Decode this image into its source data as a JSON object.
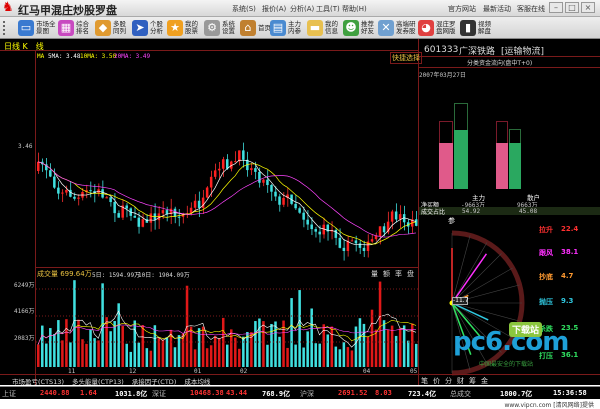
{
  "titlebar": {
    "app_title": "红马甲混庄炒股罗盘",
    "menus": [
      "系统(S)",
      "报价(A)",
      "分析(A)",
      "工具(T)",
      "帮助(H)"
    ],
    "links": [
      "官方网站",
      "最新活动",
      "客服在线"
    ],
    "window_buttons": [
      "–",
      "□",
      "×"
    ]
  },
  "toolbar": {
    "items": [
      {
        "label": "市场全景图",
        "icon": "monitor-icon",
        "color": "#3a7ad0"
      },
      {
        "label": "综合排名",
        "icon": "grid-icon",
        "color": "#c84ac0"
      },
      {
        "label": "多股同列",
        "icon": "cubes-icon",
        "color": "#e09a30"
      },
      {
        "label": "个股分析",
        "icon": "arrow-icon",
        "color": "#3060c0"
      },
      {
        "label": "我的股票",
        "icon": "star-icon",
        "color": "#f0a020"
      },
      {
        "label": "系统设置",
        "icon": "gear-icon",
        "color": "#999999"
      },
      {
        "label": "首页",
        "icon": "home-icon",
        "color": "#c08030"
      },
      {
        "label": "主力内参",
        "icon": "book-icon",
        "color": "#4a8ad0"
      },
      {
        "label": "我的信息",
        "icon": "folder-icon",
        "color": "#e8c050"
      },
      {
        "label": "推荐好友",
        "icon": "users-icon",
        "color": "#40a040"
      },
      {
        "label": "高端研发券股",
        "icon": "map-icon",
        "color": "#70a0d0"
      },
      {
        "label": "混庄罗盘网版",
        "icon": "pie-icon",
        "color": "#e04040"
      },
      {
        "label": "视频解盘",
        "icon": "film-icon",
        "color": "#333333"
      }
    ]
  },
  "kchart": {
    "title": "日线 K　线",
    "ma_label": "MA",
    "ma5": "5MA: 3.48",
    "ma10": "10MA: 3.50",
    "ma20": "20MA: 3.49",
    "quick_select": "快捷选择",
    "price_label": "3.46"
  },
  "volume": {
    "title": "成交量 699.64万",
    "vol5": "5日: 1594.99万",
    "vol10": "10日: 1904.09万",
    "tabs": [
      "量",
      "额",
      "率",
      "盘"
    ],
    "y_labels": [
      "6249万",
      "4166万",
      "2083万"
    ]
  },
  "x_labels": [
    "11",
    "12",
    "01",
    "02",
    "04",
    "05"
  ],
  "indicator_tabs": [
    "市场盈亏(CTS13)",
    "多头能量(CTP13)",
    "承接因子(CTD)",
    "成本均线"
  ],
  "right_panel": {
    "code": "601333",
    "name": "广深铁路",
    "sector": "[运输物流]",
    "flow_title": "分类资金流向(盘中T+0)",
    "date": "2007年03月27日",
    "groups": [
      {
        "label": "主力",
        "net": "-9663万",
        "share": "54.92",
        "buy": 0.62,
        "sell": 0.78
      },
      {
        "label": "散户",
        "net": "9663万",
        "share": "45.08",
        "buy": 0.62,
        "sell": 0.55
      }
    ],
    "row_labels": [
      "净买额",
      "成交占比"
    ],
    "compass_label": "参",
    "compass": [
      {
        "label": "拉升",
        "value": "22.4",
        "color": "#ff3030"
      },
      {
        "label": "跟风",
        "value": "38.1",
        "color": "#ff30ff"
      },
      {
        "label": "抄底",
        "value": "4.7",
        "color": "#ff9a30"
      },
      {
        "label": "抛压",
        "value": "9.3",
        "color": "#30c8e0"
      },
      {
        "label": "杀跌",
        "value": "23.5",
        "color": "#30e060"
      },
      {
        "label": "打压",
        "value": "36.1",
        "color": "#30e060"
      }
    ],
    "bottom_tabs": [
      "笔",
      "价",
      "分",
      "财",
      "筹",
      "金"
    ],
    "marker_value": "-11.7"
  },
  "statusbar": {
    "sh_label": "上证",
    "sh_index": "2440.88",
    "sh_change": "1.64",
    "sh_amount": "1031.8亿",
    "sz_label": "深证",
    "sz_index": "10468.38",
    "sz_change": "43.44",
    "sz_amount": "768.9亿",
    "hs_label": "沪深",
    "hs_index": "2691.52",
    "hs_change": "8.03",
    "hs_amount": "723.4亿",
    "total_label": "总成交",
    "total_amount": "1800.7亿",
    "time": "15:36:58"
  },
  "watermarks": {
    "pc6": "pc6.com",
    "pc6_tag": "下载站",
    "pc6_sub": "中国最安全的下载站",
    "footer": "www.vipcn.com [清风网络]提供"
  }
}
